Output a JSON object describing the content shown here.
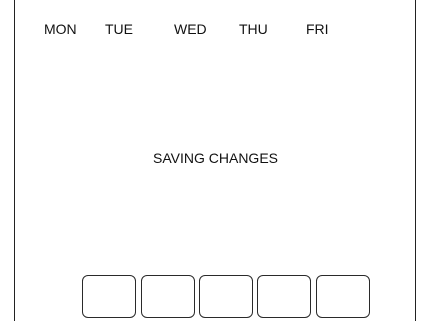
{
  "days": {
    "mon": "MON",
    "tue": "TUE",
    "wed": "WED",
    "thu": "THU",
    "fri": "FRI"
  },
  "status": {
    "message": "SAVING CHANGES"
  },
  "soft_keys": {
    "count": 5
  },
  "colors": {
    "background": "#ffffff",
    "foreground": "#111111",
    "border": "#222222"
  }
}
